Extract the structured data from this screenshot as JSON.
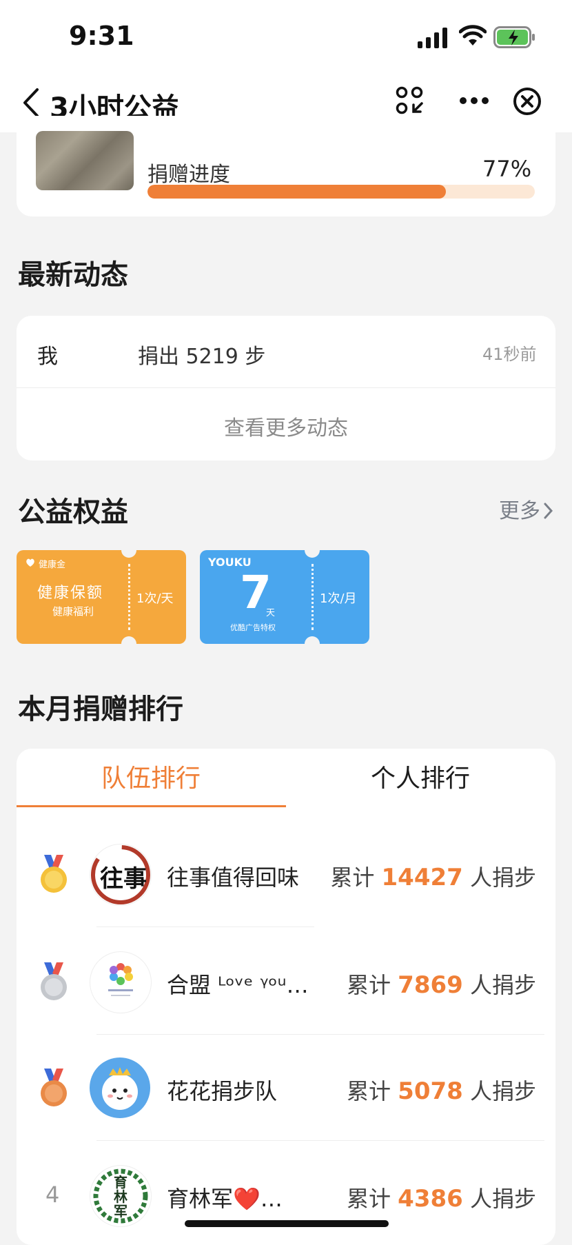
{
  "status_bar": {
    "time": "9:31"
  },
  "nav": {
    "title": "3小时公益"
  },
  "progress": {
    "label": "捐赠进度",
    "percent_text": "77%",
    "fraction": 0.77
  },
  "activity": {
    "title": "最新动态",
    "items": [
      {
        "user": "我",
        "text": "捐出 5219 步",
        "time": "41秒前"
      }
    ],
    "more_label": "查看更多动态"
  },
  "benefits": {
    "title": "公益权益",
    "more_label": "更多",
    "tickets": [
      {
        "brand": "健康金",
        "title": "健康保额",
        "subtitle": "健康福利",
        "freq": "1次/天"
      },
      {
        "brand": "YOUKU",
        "big": "7",
        "unit": "天",
        "subtitle": "优酷广告特权",
        "freq": "1次/月"
      }
    ]
  },
  "ranking": {
    "title": "本月捐赠排行",
    "tabs": [
      {
        "label": "队伍排行",
        "active": true
      },
      {
        "label": "个人排行",
        "active": false
      }
    ],
    "rows": [
      {
        "rank": 1,
        "name": "往事值得回味",
        "prefix": "累计",
        "count": "14427",
        "suffix": "人捐步",
        "avatar_text": "往事"
      },
      {
        "rank": 2,
        "name": "合盟 ᴸᵒᵛᵉ ᵞᵒᵘ…",
        "prefix": "累计",
        "count": "7869",
        "suffix": "人捐步"
      },
      {
        "rank": 3,
        "name": "花花捐步队",
        "prefix": "累计",
        "count": "5078",
        "suffix": "人捐步"
      },
      {
        "rank": 4,
        "rank_label": "4",
        "name": "育林军❤️…",
        "prefix": "累计",
        "count": "4386",
        "suffix": "人捐步",
        "avatar_text": "育林军"
      }
    ]
  },
  "colors": {
    "accent": "#ef7f37",
    "ticket_orange": "#f5a83d",
    "ticket_blue": "#4aa6ee"
  }
}
